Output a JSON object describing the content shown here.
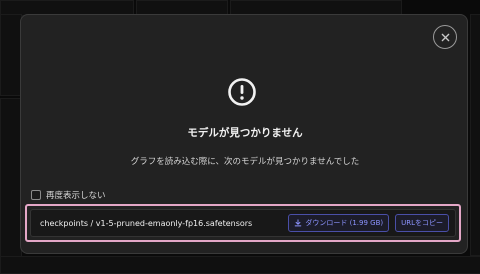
{
  "dialog": {
    "title": "モデルが見つかりません",
    "message": "グラフを読み込む際に、次のモデルが見つかりませんでした",
    "dont_show_again": "再度表示しない",
    "model": {
      "path": "checkpoints / v1-5-pruned-emaonly-fp16.safetensors",
      "download_label": "ダウンロード (1.99 GB)",
      "copy_url_label": "URLをコピー"
    }
  },
  "colors": {
    "modal_bg": "#222222",
    "accent": "#8c93ff",
    "highlight_border": "#e4a7c7"
  },
  "icons": {
    "close": "close-icon",
    "warning": "exclamation-circle-icon",
    "download": "download-icon"
  }
}
